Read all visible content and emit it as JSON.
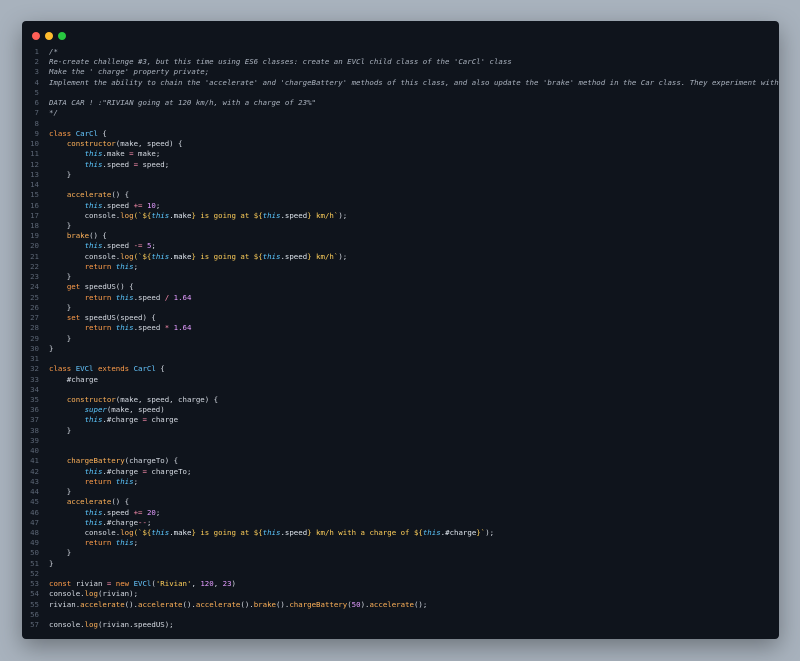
{
  "window": {
    "controls": [
      {
        "name": "close",
        "color": "#ff5f57"
      },
      {
        "name": "minimize",
        "color": "#febc2e"
      },
      {
        "name": "zoom",
        "color": "#28c840"
      }
    ]
  },
  "editor": {
    "lines": [
      [
        {
          "t": "/*",
          "c": "comment"
        }
      ],
      [
        {
          "t": "Re-create challenge #3, but this time using ES6 classes: create an EVCl child class of the 'CarCl' class",
          "c": "comment"
        }
      ],
      [
        {
          "t": "Make the ' charge' property private;",
          "c": "comment"
        }
      ],
      [
        {
          "t": "Implement the ability to chain the 'accelerate' and 'chargeBattery' methods of this class, and also update the 'brake' method in the Car class. They experiment with chaining",
          "c": "comment"
        }
      ],
      [],
      [
        {
          "t": "DATA CAR ! :\"RIVIAN going at 120 km/h, with a charge of 23%\"",
          "c": "comment"
        }
      ],
      [
        {
          "t": "*/",
          "c": "comment"
        }
      ],
      [],
      [
        {
          "t": "class ",
          "c": "keyword"
        },
        {
          "t": "CarCl",
          "c": "class"
        },
        {
          "t": " {",
          "c": "plain"
        }
      ],
      [
        {
          "t": "    "
        },
        {
          "t": "constructor",
          "c": "func"
        },
        {
          "t": "(make, speed) {",
          "c": "plain"
        }
      ],
      [
        {
          "t": "        "
        },
        {
          "t": "this",
          "c": "this"
        },
        {
          "t": ".make ",
          "c": "plain"
        },
        {
          "t": "=",
          "c": "op"
        },
        {
          "t": " make;",
          "c": "plain"
        }
      ],
      [
        {
          "t": "        "
        },
        {
          "t": "this",
          "c": "this"
        },
        {
          "t": ".speed ",
          "c": "plain"
        },
        {
          "t": "=",
          "c": "op"
        },
        {
          "t": " speed;",
          "c": "plain"
        }
      ],
      [
        {
          "t": "    }",
          "c": "plain"
        }
      ],
      [],
      [
        {
          "t": "    "
        },
        {
          "t": "accelerate",
          "c": "func"
        },
        {
          "t": "() {",
          "c": "plain"
        }
      ],
      [
        {
          "t": "        "
        },
        {
          "t": "this",
          "c": "this"
        },
        {
          "t": ".speed ",
          "c": "plain"
        },
        {
          "t": "+=",
          "c": "op"
        },
        {
          "t": " ",
          "c": "plain"
        },
        {
          "t": "10",
          "c": "number"
        },
        {
          "t": ";",
          "c": "plain"
        }
      ],
      [
        {
          "t": "        console.",
          "c": "plain"
        },
        {
          "t": "log",
          "c": "func"
        },
        {
          "t": "(`${",
          "c": "string"
        },
        {
          "t": "this",
          "c": "this"
        },
        {
          "t": ".make",
          "c": "template-expr"
        },
        {
          "t": "} is going at ${",
          "c": "string"
        },
        {
          "t": "this",
          "c": "this"
        },
        {
          "t": ".speed",
          "c": "template-expr"
        },
        {
          "t": "} km/h`",
          "c": "string"
        },
        {
          "t": ");",
          "c": "plain"
        }
      ],
      [
        {
          "t": "    }",
          "c": "plain"
        }
      ],
      [
        {
          "t": "    "
        },
        {
          "t": "brake",
          "c": "func"
        },
        {
          "t": "() {",
          "c": "plain"
        }
      ],
      [
        {
          "t": "        "
        },
        {
          "t": "this",
          "c": "this"
        },
        {
          "t": ".speed ",
          "c": "plain"
        },
        {
          "t": "-=",
          "c": "op"
        },
        {
          "t": " ",
          "c": "plain"
        },
        {
          "t": "5",
          "c": "number"
        },
        {
          "t": ";",
          "c": "plain"
        }
      ],
      [
        {
          "t": "        console.",
          "c": "plain"
        },
        {
          "t": "log",
          "c": "func"
        },
        {
          "t": "(`${",
          "c": "string"
        },
        {
          "t": "this",
          "c": "this"
        },
        {
          "t": ".make",
          "c": "template-expr"
        },
        {
          "t": "} is going at ${",
          "c": "string"
        },
        {
          "t": "this",
          "c": "this"
        },
        {
          "t": ".speed",
          "c": "template-expr"
        },
        {
          "t": "} km/h`",
          "c": "string"
        },
        {
          "t": ");",
          "c": "plain"
        }
      ],
      [
        {
          "t": "        "
        },
        {
          "t": "return ",
          "c": "keyword"
        },
        {
          "t": "this",
          "c": "this"
        },
        {
          "t": ";",
          "c": "plain"
        }
      ],
      [
        {
          "t": "    }",
          "c": "plain"
        }
      ],
      [
        {
          "t": "    "
        },
        {
          "t": "get ",
          "c": "keyword"
        },
        {
          "t": "speedUS",
          "c": "plain"
        },
        {
          "t": "() {",
          "c": "plain"
        }
      ],
      [
        {
          "t": "        "
        },
        {
          "t": "return ",
          "c": "keyword"
        },
        {
          "t": "this",
          "c": "this"
        },
        {
          "t": ".speed ",
          "c": "plain"
        },
        {
          "t": "/",
          "c": "op"
        },
        {
          "t": " ",
          "c": "plain"
        },
        {
          "t": "1.64",
          "c": "number"
        }
      ],
      [
        {
          "t": "    }",
          "c": "plain"
        }
      ],
      [
        {
          "t": "    "
        },
        {
          "t": "set ",
          "c": "keyword"
        },
        {
          "t": "speedUS",
          "c": "plain"
        },
        {
          "t": "(speed) {",
          "c": "plain"
        }
      ],
      [
        {
          "t": "        "
        },
        {
          "t": "return ",
          "c": "keyword"
        },
        {
          "t": "this",
          "c": "this"
        },
        {
          "t": ".speed ",
          "c": "plain"
        },
        {
          "t": "*",
          "c": "op"
        },
        {
          "t": " ",
          "c": "plain"
        },
        {
          "t": "1.64",
          "c": "number"
        }
      ],
      [
        {
          "t": "    }",
          "c": "plain"
        }
      ],
      [
        {
          "t": "}",
          "c": "plain"
        }
      ],
      [],
      [
        {
          "t": "class ",
          "c": "keyword"
        },
        {
          "t": "EVCl",
          "c": "class"
        },
        {
          "t": " extends ",
          "c": "keyword"
        },
        {
          "t": "CarCl",
          "c": "class"
        },
        {
          "t": " {",
          "c": "plain"
        }
      ],
      [
        {
          "t": "    #charge",
          "c": "plain"
        }
      ],
      [],
      [
        {
          "t": "    "
        },
        {
          "t": "constructor",
          "c": "func"
        },
        {
          "t": "(make, speed, charge) {",
          "c": "plain"
        }
      ],
      [
        {
          "t": "        "
        },
        {
          "t": "super",
          "c": "this"
        },
        {
          "t": "(make, speed)",
          "c": "plain"
        }
      ],
      [
        {
          "t": "        "
        },
        {
          "t": "this",
          "c": "this"
        },
        {
          "t": ".#charge ",
          "c": "plain"
        },
        {
          "t": "=",
          "c": "op"
        },
        {
          "t": " charge",
          "c": "plain"
        }
      ],
      [
        {
          "t": "    }",
          "c": "plain"
        }
      ],
      [],
      [],
      [
        {
          "t": "    "
        },
        {
          "t": "chargeBattery",
          "c": "func"
        },
        {
          "t": "(chargeTo) {",
          "c": "plain"
        }
      ],
      [
        {
          "t": "        "
        },
        {
          "t": "this",
          "c": "this"
        },
        {
          "t": ".#charge ",
          "c": "plain"
        },
        {
          "t": "=",
          "c": "op"
        },
        {
          "t": " chargeTo;",
          "c": "plain"
        }
      ],
      [
        {
          "t": "        "
        },
        {
          "t": "return ",
          "c": "keyword"
        },
        {
          "t": "this",
          "c": "this"
        },
        {
          "t": ";",
          "c": "plain"
        }
      ],
      [
        {
          "t": "    }",
          "c": "plain"
        }
      ],
      [
        {
          "t": "    "
        },
        {
          "t": "accelerate",
          "c": "func"
        },
        {
          "t": "() {",
          "c": "plain"
        }
      ],
      [
        {
          "t": "        "
        },
        {
          "t": "this",
          "c": "this"
        },
        {
          "t": ".speed ",
          "c": "plain"
        },
        {
          "t": "+=",
          "c": "op"
        },
        {
          "t": " ",
          "c": "plain"
        },
        {
          "t": "20",
          "c": "number"
        },
        {
          "t": ";",
          "c": "plain"
        }
      ],
      [
        {
          "t": "        "
        },
        {
          "t": "this",
          "c": "this"
        },
        {
          "t": ".#charge",
          "c": "plain"
        },
        {
          "t": "--",
          "c": "op"
        },
        {
          "t": ";",
          "c": "plain"
        }
      ],
      [
        {
          "t": "        console.",
          "c": "plain"
        },
        {
          "t": "log",
          "c": "func"
        },
        {
          "t": "(`${",
          "c": "string"
        },
        {
          "t": "this",
          "c": "this"
        },
        {
          "t": ".make",
          "c": "template-expr"
        },
        {
          "t": "} is going at ${",
          "c": "string"
        },
        {
          "t": "this",
          "c": "this"
        },
        {
          "t": ".speed",
          "c": "template-expr"
        },
        {
          "t": "} km/h with a charge of ${",
          "c": "string"
        },
        {
          "t": "this",
          "c": "this"
        },
        {
          "t": ".#charge",
          "c": "template-expr"
        },
        {
          "t": "}`",
          "c": "string"
        },
        {
          "t": ");",
          "c": "plain"
        }
      ],
      [
        {
          "t": "        "
        },
        {
          "t": "return ",
          "c": "keyword"
        },
        {
          "t": "this",
          "c": "this"
        },
        {
          "t": ";",
          "c": "plain"
        }
      ],
      [
        {
          "t": "    }",
          "c": "plain"
        }
      ],
      [
        {
          "t": "}",
          "c": "plain"
        }
      ],
      [],
      [
        {
          "t": "const ",
          "c": "keyword"
        },
        {
          "t": "rivian ",
          "c": "plain"
        },
        {
          "t": "=",
          "c": "op"
        },
        {
          "t": " ",
          "c": "plain"
        },
        {
          "t": "new ",
          "c": "keyword"
        },
        {
          "t": "EVCl",
          "c": "class"
        },
        {
          "t": "(",
          "c": "plain"
        },
        {
          "t": "'Rivian'",
          "c": "string"
        },
        {
          "t": ", ",
          "c": "plain"
        },
        {
          "t": "120",
          "c": "number"
        },
        {
          "t": ", ",
          "c": "plain"
        },
        {
          "t": "23",
          "c": "number"
        },
        {
          "t": ")",
          "c": "plain"
        }
      ],
      [
        {
          "t": "console.",
          "c": "plain"
        },
        {
          "t": "log",
          "c": "func"
        },
        {
          "t": "(rivian);",
          "c": "plain"
        }
      ],
      [
        {
          "t": "rivian.",
          "c": "plain"
        },
        {
          "t": "accelerate",
          "c": "func"
        },
        {
          "t": "().",
          "c": "plain"
        },
        {
          "t": "accelerate",
          "c": "func"
        },
        {
          "t": "().",
          "c": "plain"
        },
        {
          "t": "accelerate",
          "c": "func"
        },
        {
          "t": "().",
          "c": "plain"
        },
        {
          "t": "brake",
          "c": "func"
        },
        {
          "t": "().",
          "c": "plain"
        },
        {
          "t": "chargeBattery",
          "c": "func"
        },
        {
          "t": "(",
          "c": "plain"
        },
        {
          "t": "50",
          "c": "number"
        },
        {
          "t": ").",
          "c": "plain"
        },
        {
          "t": "accelerate",
          "c": "func"
        },
        {
          "t": "();",
          "c": "plain"
        }
      ],
      [],
      [
        {
          "t": "console.",
          "c": "plain"
        },
        {
          "t": "log",
          "c": "func"
        },
        {
          "t": "(rivian.speedUS);",
          "c": "plain"
        }
      ]
    ]
  }
}
